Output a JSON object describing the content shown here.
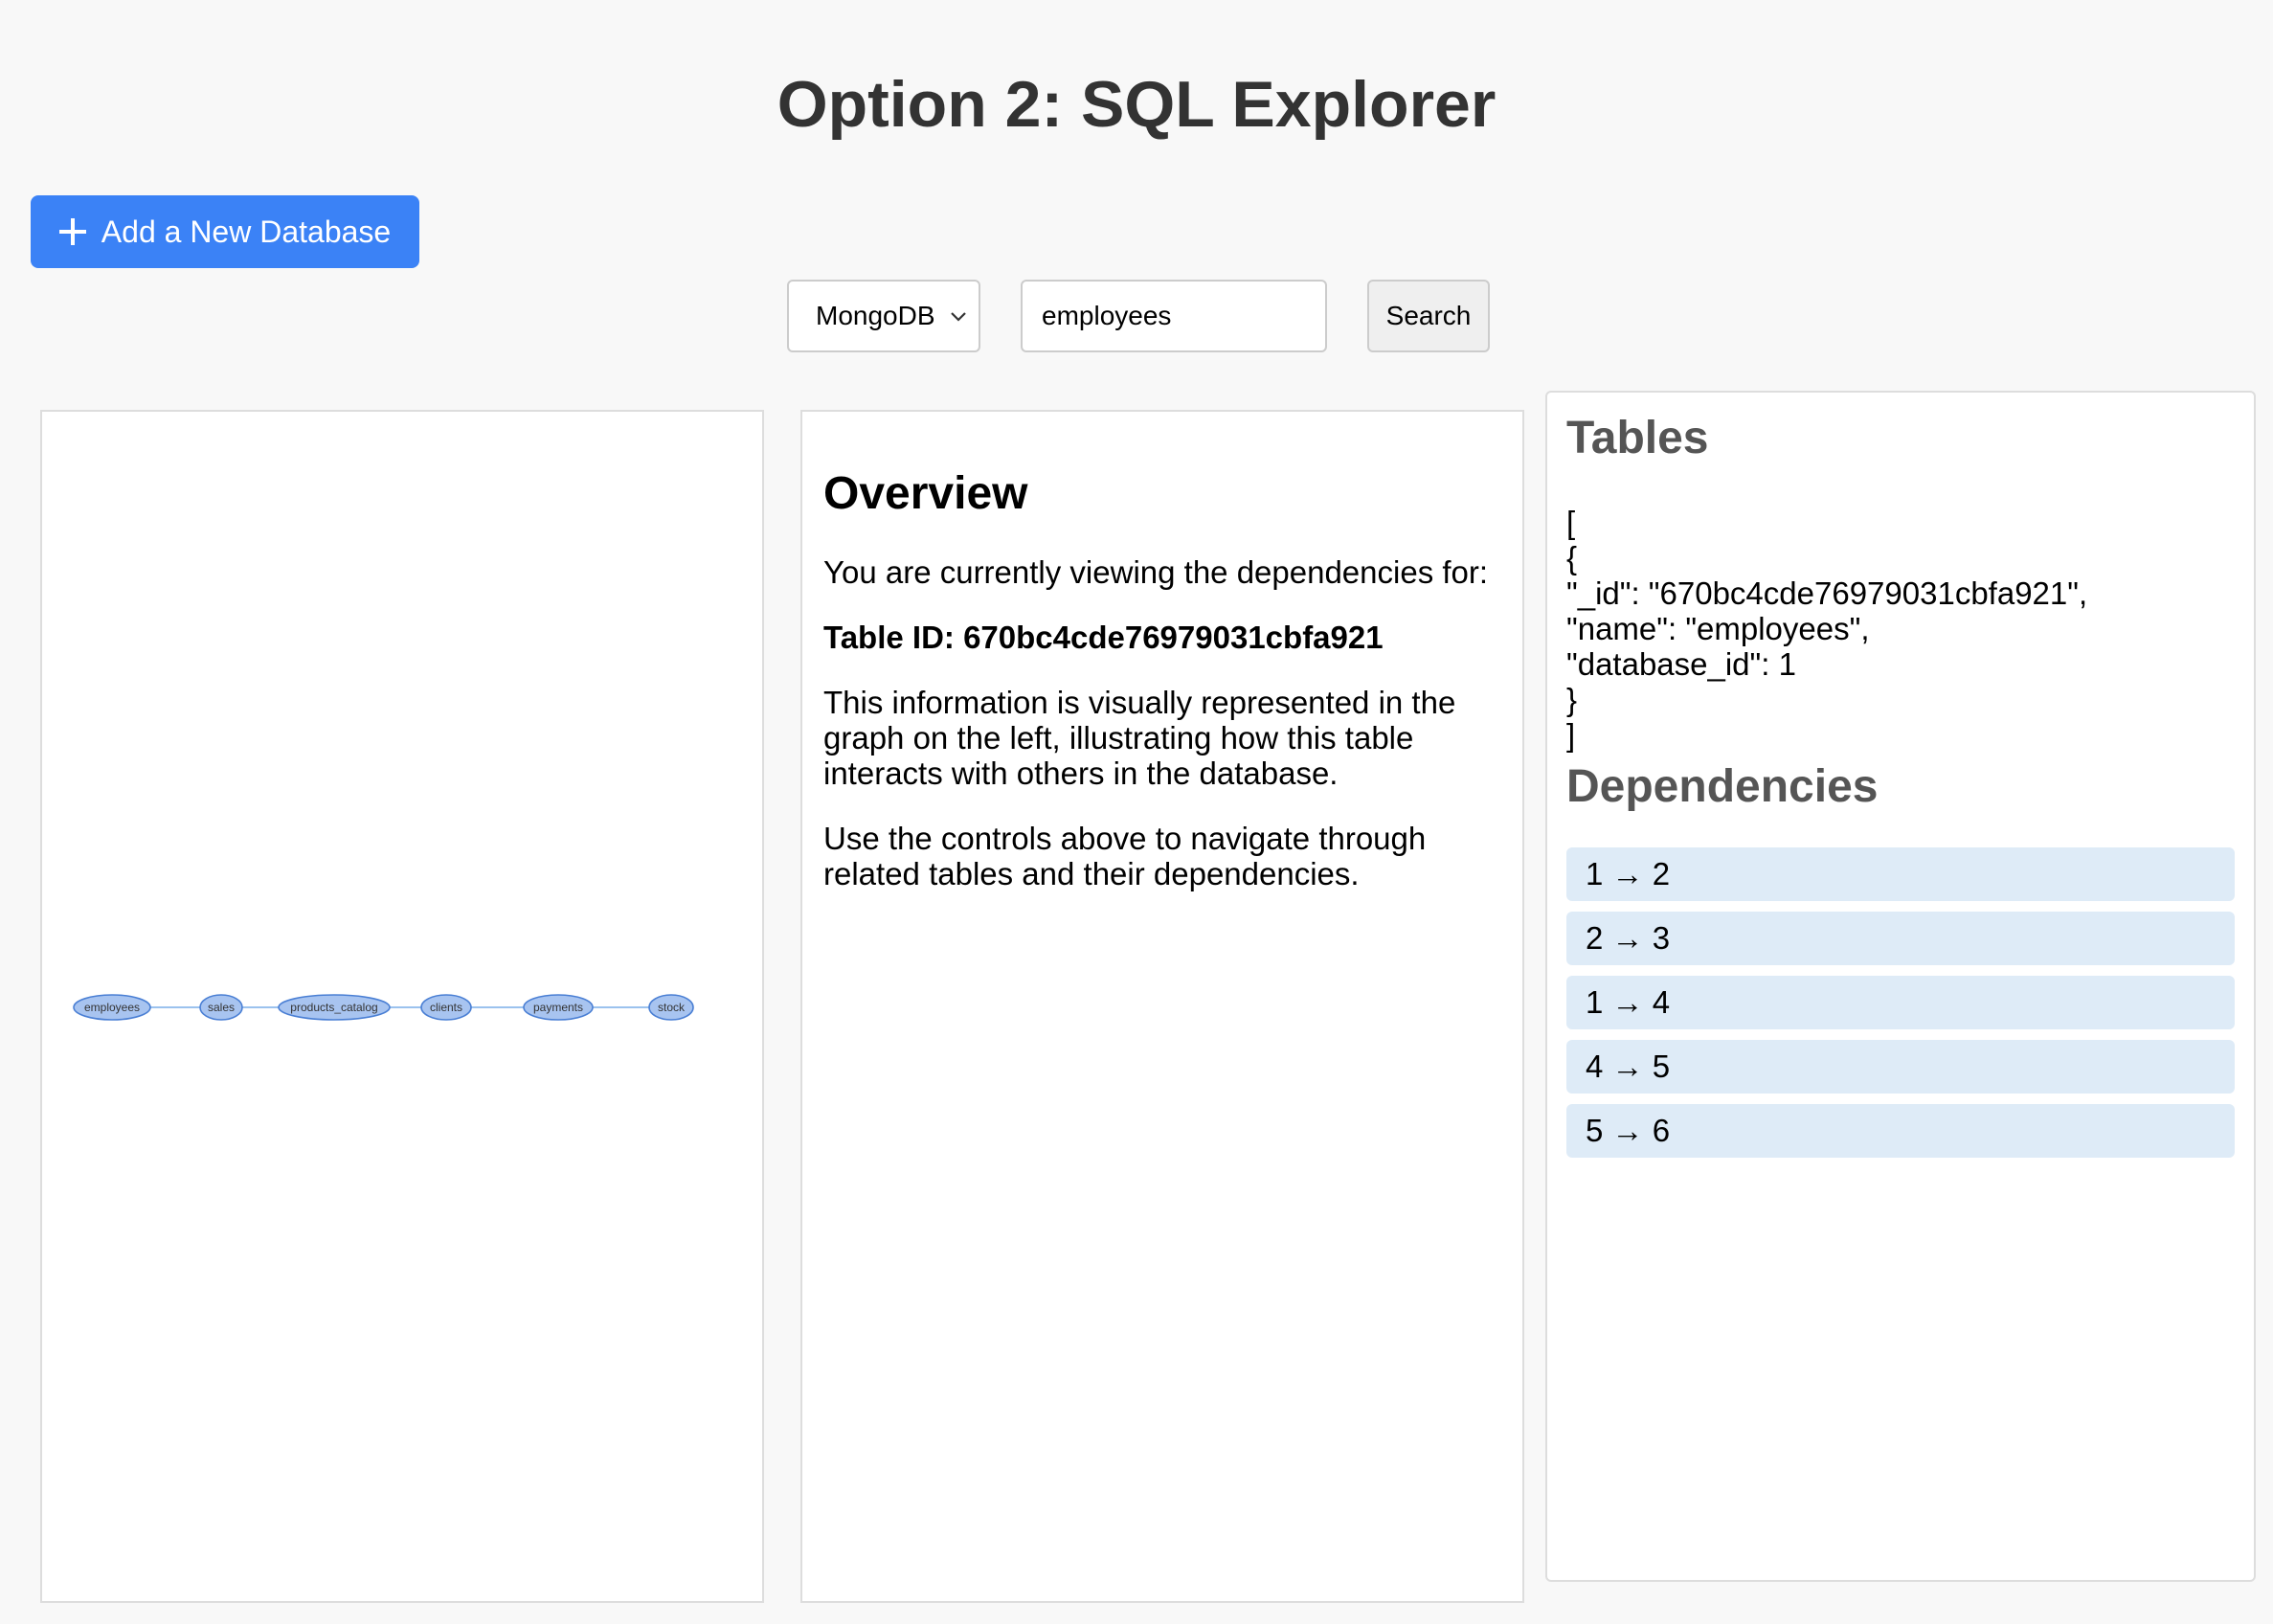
{
  "page": {
    "title": "Option 2: SQL Explorer"
  },
  "toolbar": {
    "add_database_label": "Add a New Database",
    "db_select_value": "MongoDB",
    "search_value": "employees",
    "search_label": "Search"
  },
  "graph": {
    "nodes": [
      "employees",
      "sales",
      "products_catalog",
      "clients",
      "payments",
      "stock"
    ],
    "edges": [
      [
        1,
        2
      ],
      [
        2,
        3
      ],
      [
        3,
        4
      ],
      [
        4,
        5
      ],
      [
        5,
        6
      ]
    ],
    "colors": {
      "node_fill": "#a8c4f0",
      "node_stroke": "#4a7fd4",
      "edge": "#7aaee8"
    }
  },
  "overview": {
    "heading": "Overview",
    "p1": "You are currently viewing the dependencies for:",
    "table_id": "Table ID: 670bc4cde76979031cbfa921",
    "p2": "This information is visually represented in the graph on the left, illustrating how this table interacts with others in the database.",
    "p3": "Use the controls above to navigate through related tables and their dependencies."
  },
  "tables": {
    "heading": "Tables",
    "json_text": "[\n{\n\"_id\": \"670bc4cde76979031cbfa921\",\n\"name\": \"employees\",\n\"database_id\": 1\n}\n]"
  },
  "dependencies": {
    "heading": "Dependencies",
    "items": [
      "1 → 2",
      "2 → 3",
      "1 → 4",
      "4 → 5",
      "5 → 6"
    ]
  },
  "colors": {
    "accent": "#3b82f6",
    "dep_item_bg": "#deebf7",
    "heading_gray": "#555555"
  }
}
